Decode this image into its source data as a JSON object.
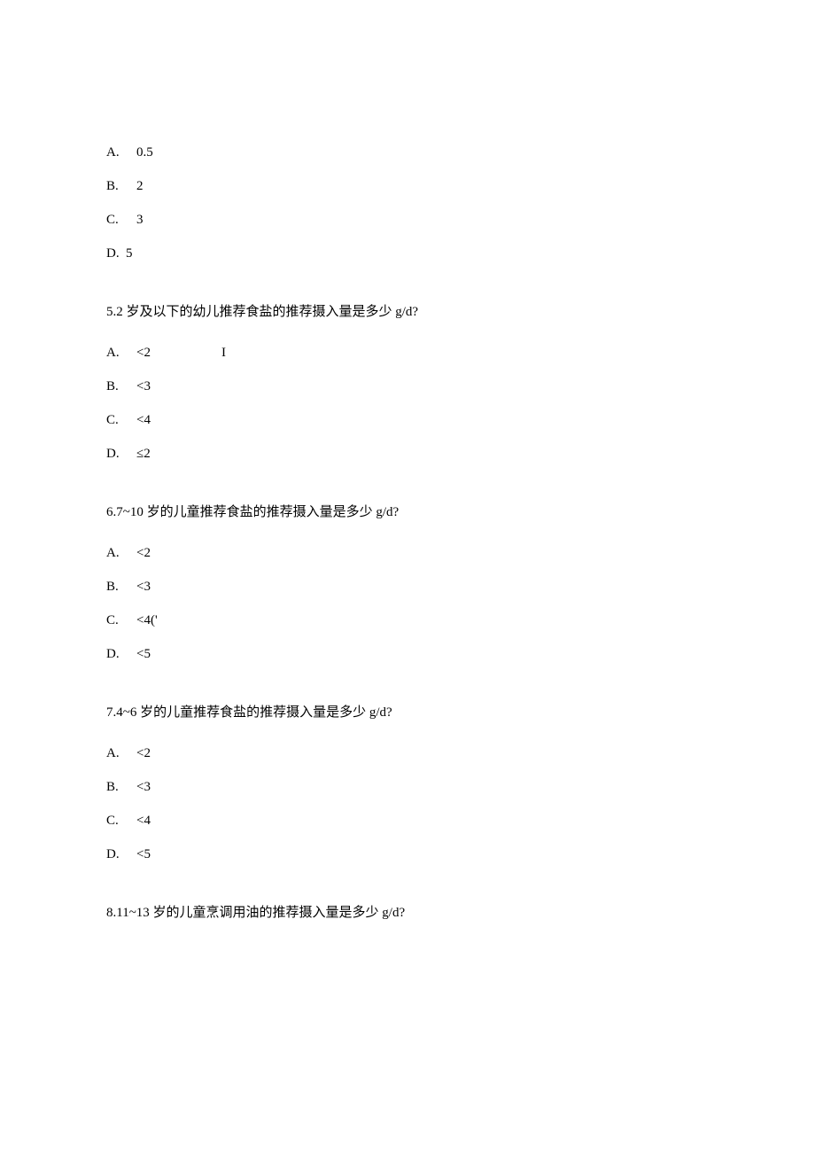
{
  "blocks": [
    {
      "type": "options",
      "items": [
        {
          "letter": "A.",
          "value": "0.5",
          "style": "normal"
        },
        {
          "letter": "B.",
          "value": "2",
          "style": "normal"
        },
        {
          "letter": "C.",
          "value": "3",
          "style": "normal"
        },
        {
          "letter": "D.",
          "value": "5",
          "style": "tight"
        }
      ]
    },
    {
      "type": "question",
      "text": "5.2 岁及以下的幼儿推荐食盐的推荐摄入量是多少 g/d?"
    },
    {
      "type": "options",
      "items": [
        {
          "letter": "A.",
          "value": "<2",
          "extra": "I",
          "style": "normal"
        },
        {
          "letter": "B.",
          "value": "<3",
          "style": "normal"
        },
        {
          "letter": "C.",
          "value": "<4",
          "style": "normal"
        },
        {
          "letter": "D.",
          "value": "≤2",
          "style": "normal"
        }
      ]
    },
    {
      "type": "question",
      "text": "6.7~10 岁的儿童推荐食盐的推荐摄入量是多少 g/d?"
    },
    {
      "type": "options",
      "items": [
        {
          "letter": "A.",
          "value": "<2",
          "style": "normal"
        },
        {
          "letter": "B.",
          "value": "<3",
          "style": "normal"
        },
        {
          "letter": "C.",
          "value": "<4('",
          "style": "normal"
        },
        {
          "letter": "D.",
          "value": "<5",
          "style": "normal"
        }
      ]
    },
    {
      "type": "question",
      "text": "7.4~6 岁的儿童推荐食盐的推荐摄入量是多少 g/d?"
    },
    {
      "type": "options",
      "items": [
        {
          "letter": "A.",
          "value": "<2",
          "style": "normal"
        },
        {
          "letter": "B.",
          "value": "<3",
          "style": "normal"
        },
        {
          "letter": "C.",
          "value": "<4",
          "style": "normal"
        },
        {
          "letter": "D.",
          "value": "<5",
          "style": "normal"
        }
      ]
    },
    {
      "type": "question",
      "text": "8.11~13 岁的儿童烹调用油的推荐摄入量是多少 g/d?"
    }
  ]
}
